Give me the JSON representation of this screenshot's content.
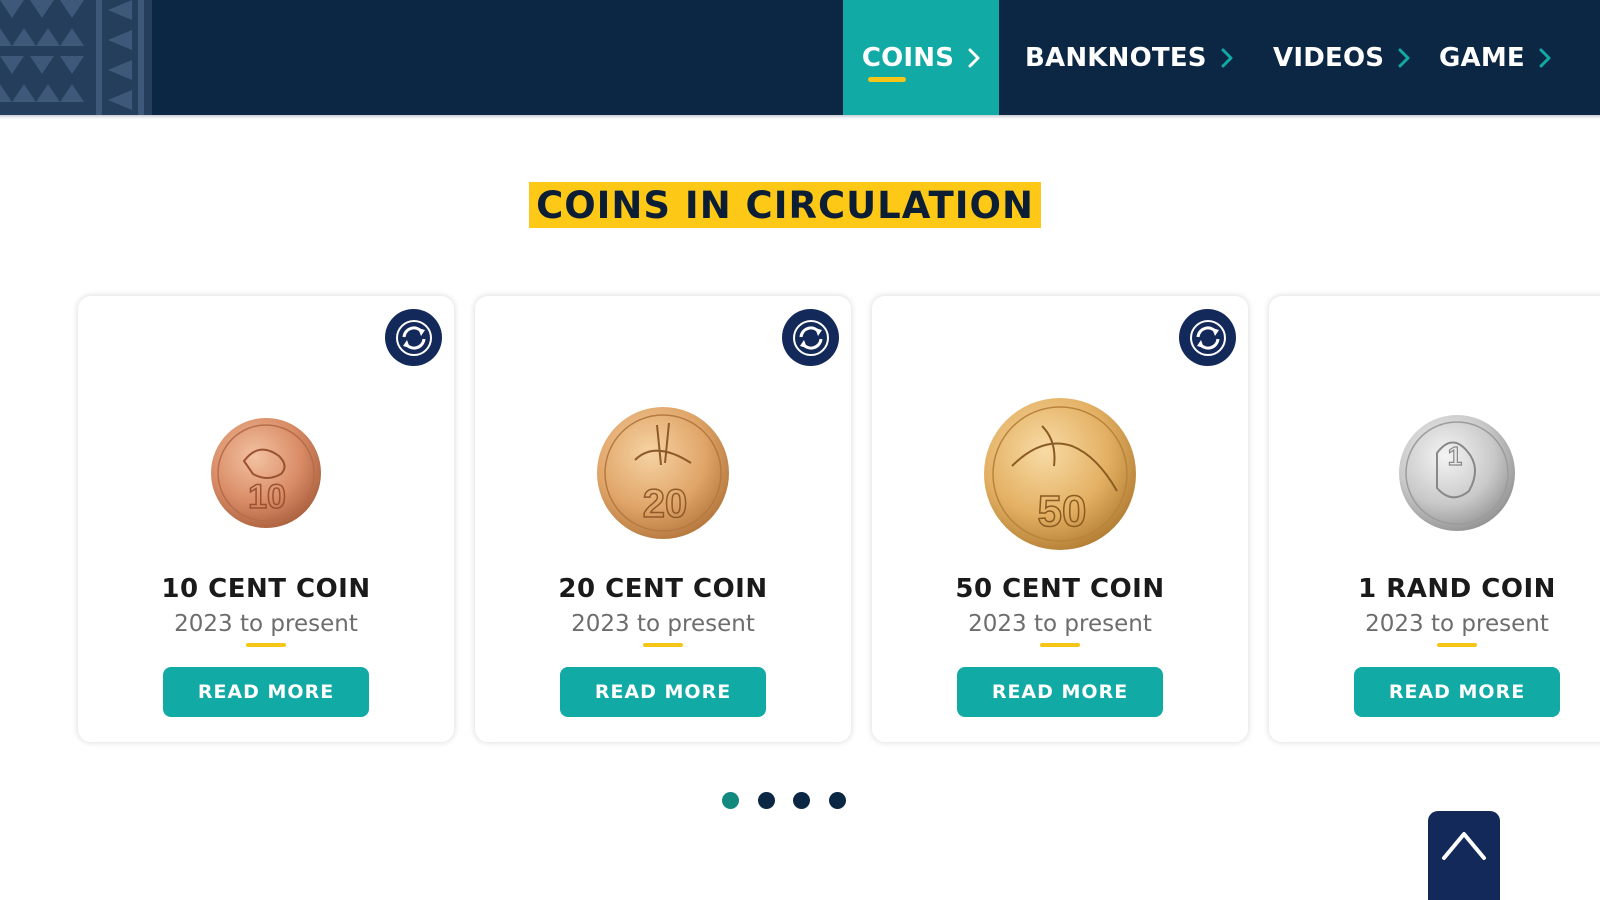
{
  "nav": {
    "items": [
      {
        "label": "COINS",
        "active": true
      },
      {
        "label": "BANKNOTES",
        "active": false
      },
      {
        "label": "VIDEOS",
        "active": false
      },
      {
        "label": "GAME",
        "active": false
      }
    ]
  },
  "section": {
    "title": "COINS IN CIRCULATION"
  },
  "cards": [
    {
      "title": "10 CENT COIN",
      "subtitle": "2023 to present",
      "button": "READ MORE",
      "coin_label": "10",
      "coin_color": "#d98c66"
    },
    {
      "title": "20 CENT COIN",
      "subtitle": "2023 to present",
      "button": "READ MORE",
      "coin_label": "20",
      "coin_color": "#e0a569"
    },
    {
      "title": "50 CENT COIN",
      "subtitle": "2023 to present",
      "button": "READ MORE",
      "coin_label": "50",
      "coin_color": "#e3b063"
    },
    {
      "title": "1 RAND COIN",
      "subtitle": "2023 to present",
      "button": "READ MORE",
      "coin_label": "1",
      "coin_color": "#c9c9c9"
    }
  ],
  "carousel": {
    "total_pages": 4,
    "active_page": 1
  },
  "colors": {
    "header": "#0c2744",
    "accent_teal": "#12aaa5",
    "accent_yellow": "#fdc816",
    "navy_button": "#13295a"
  }
}
